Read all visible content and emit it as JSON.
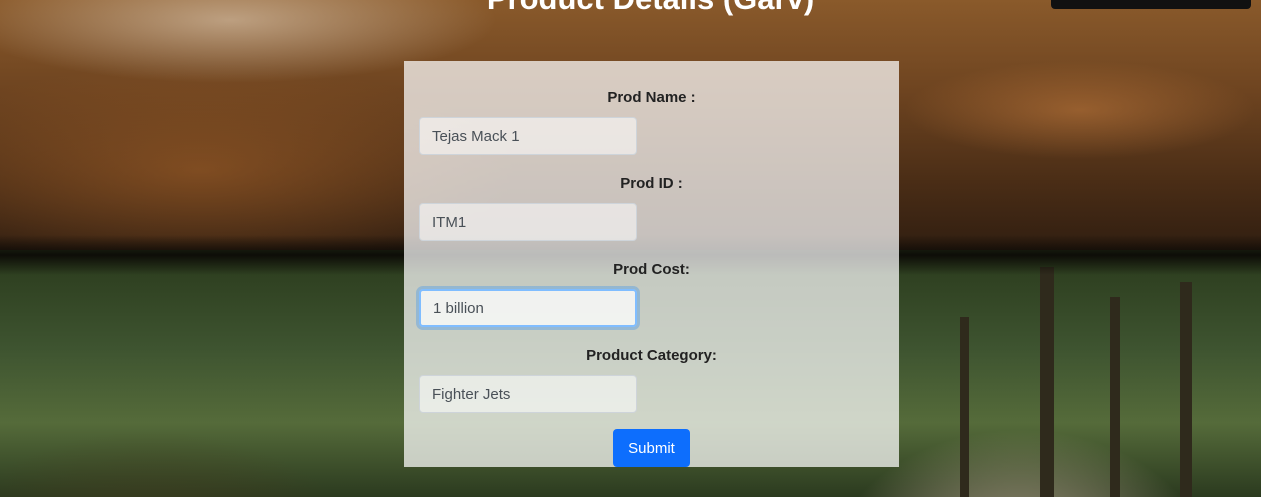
{
  "page": {
    "title": "Product Details (Garv)"
  },
  "form": {
    "prod_name": {
      "label": "Prod Name :",
      "value": "Tejas Mack 1"
    },
    "prod_id": {
      "label": "Prod ID :",
      "value": "ITM1"
    },
    "prod_cost": {
      "label": "Prod Cost:",
      "value": "1 billion"
    },
    "product_category": {
      "label": "Product Category:",
      "value": "Fighter Jets"
    },
    "submit_label": "Submit"
  },
  "colors": {
    "submit_button": "#0d6efd",
    "focus_ring": "#80bdff",
    "panel_background": "rgba(255,255,255,0.72)"
  }
}
